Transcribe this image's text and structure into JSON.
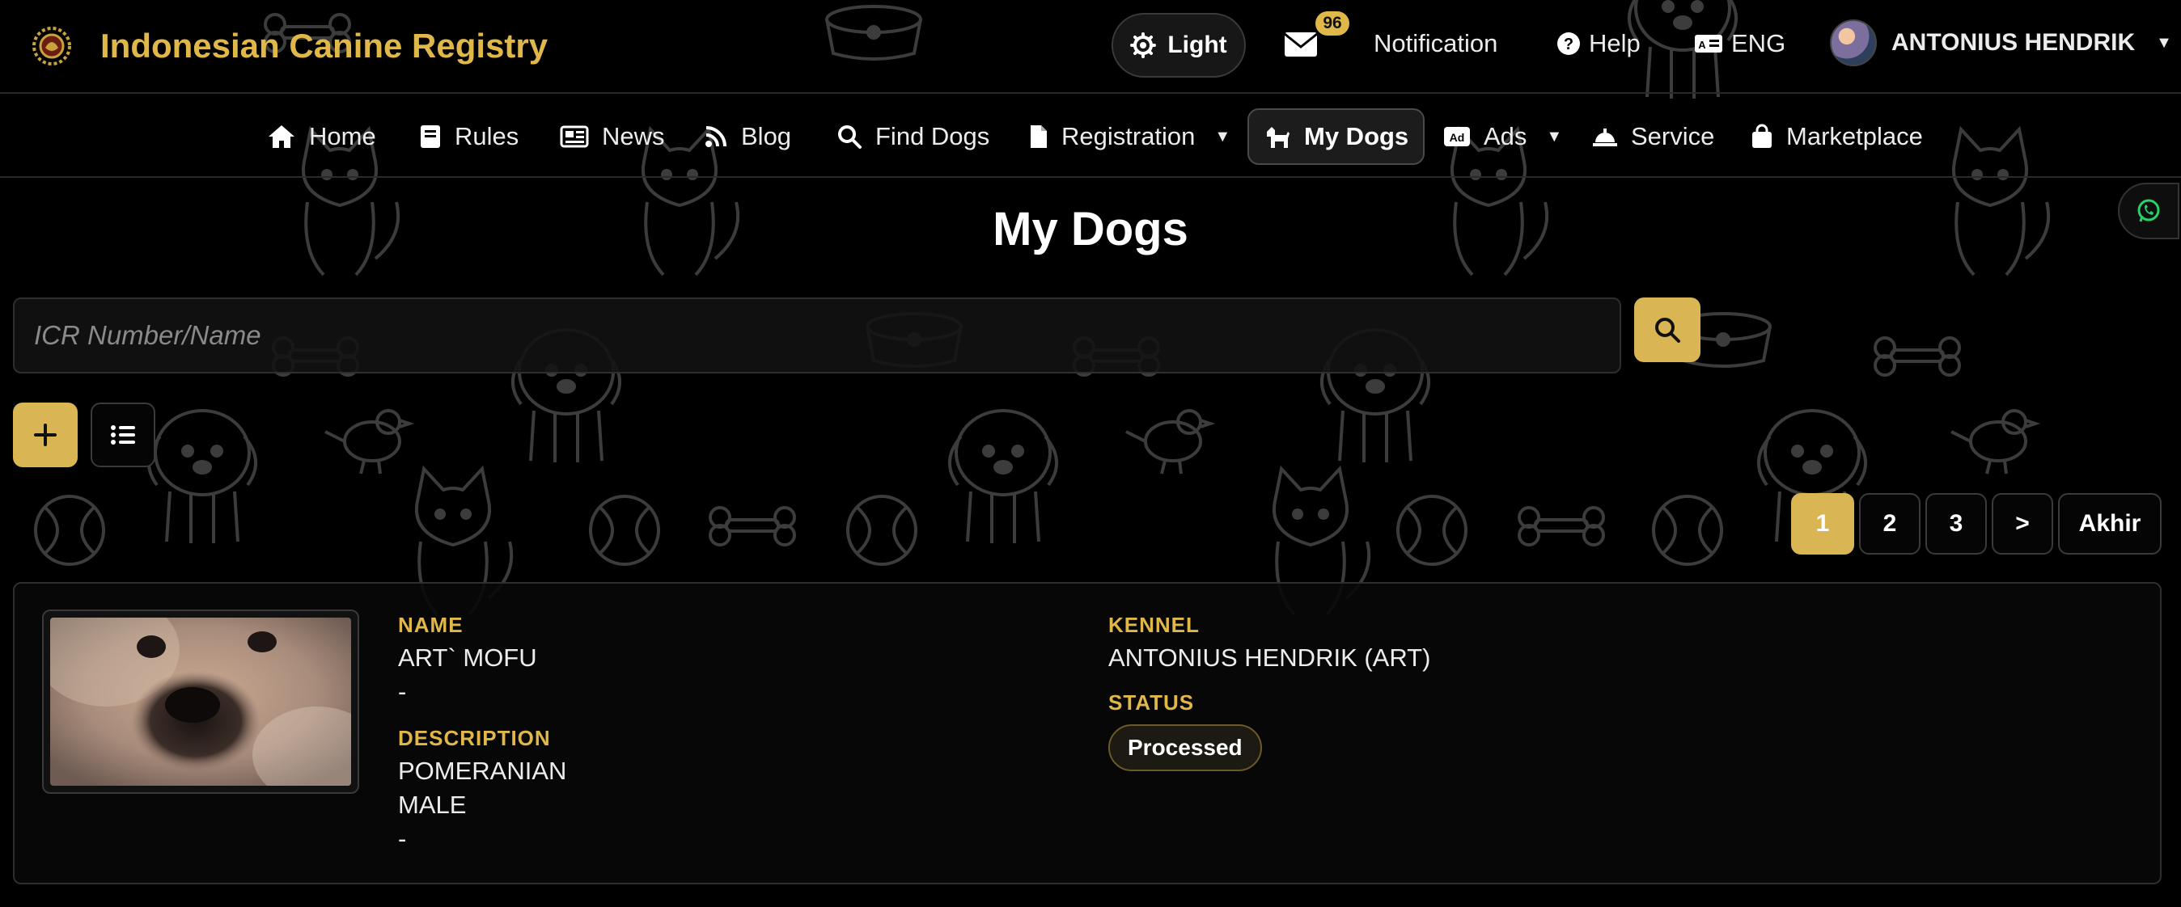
{
  "app": {
    "title": "Indonesian Canine Registry",
    "accent_color": "#e0b84a"
  },
  "topbar": {
    "theme_label": "Light",
    "mail_count": "96",
    "notification_label": "Notification",
    "help_label": "Help",
    "language_label": "ENG",
    "user_name": "ANTONIUS HENDRIK"
  },
  "nav": {
    "home": "Home",
    "rules": "Rules",
    "news": "News",
    "blog": "Blog",
    "find_dogs": "Find Dogs",
    "registration": "Registration",
    "my_dogs": "My Dogs",
    "ads": "Ads",
    "service": "Service",
    "marketplace": "Marketplace"
  },
  "page": {
    "title": "My Dogs",
    "search_placeholder": "ICR Number/Name"
  },
  "pagination": {
    "pages": [
      "1",
      "2",
      "3"
    ],
    "next": ">",
    "last": "Akhir",
    "current": "1"
  },
  "dogs": [
    {
      "name_label": "NAME",
      "name": "ART` MOFU",
      "name_extra": "-",
      "description_label": "DESCRIPTION",
      "breed": "POMERANIAN",
      "sex": "MALE",
      "description_extra": "-",
      "kennel_label": "KENNEL",
      "kennel": "ANTONIUS HENDRIK (ART)",
      "status_label": "STATUS",
      "status": "Processed"
    }
  ]
}
